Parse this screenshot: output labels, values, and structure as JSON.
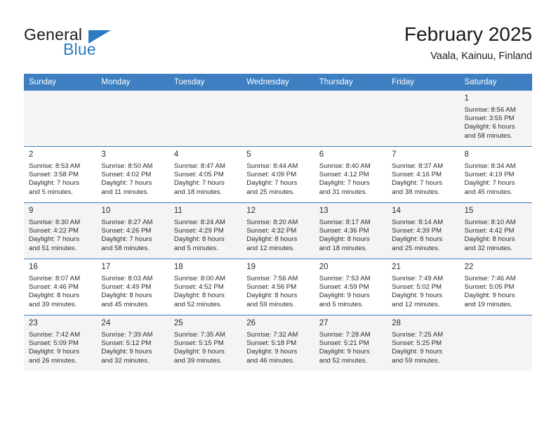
{
  "brand": {
    "name_top": "General",
    "name_bottom": "Blue",
    "accent_color": "#2b7cc0"
  },
  "header": {
    "title": "February 2025",
    "location": "Vaala, Kainuu, Finland"
  },
  "calendar": {
    "header_bg": "#3d7fc1",
    "shaded_row_bg": "#f4f4f4",
    "weekdays": [
      "Sunday",
      "Monday",
      "Tuesday",
      "Wednesday",
      "Thursday",
      "Friday",
      "Saturday"
    ],
    "weeks": [
      [
        {
          "day": "",
          "lines": []
        },
        {
          "day": "",
          "lines": []
        },
        {
          "day": "",
          "lines": []
        },
        {
          "day": "",
          "lines": []
        },
        {
          "day": "",
          "lines": []
        },
        {
          "day": "",
          "lines": []
        },
        {
          "day": "1",
          "lines": [
            "Sunrise: 8:56 AM",
            "Sunset: 3:55 PM",
            "Daylight: 6 hours",
            "and 58 minutes."
          ]
        }
      ],
      [
        {
          "day": "2",
          "lines": [
            "Sunrise: 8:53 AM",
            "Sunset: 3:58 PM",
            "Daylight: 7 hours",
            "and 5 minutes."
          ]
        },
        {
          "day": "3",
          "lines": [
            "Sunrise: 8:50 AM",
            "Sunset: 4:02 PM",
            "Daylight: 7 hours",
            "and 11 minutes."
          ]
        },
        {
          "day": "4",
          "lines": [
            "Sunrise: 8:47 AM",
            "Sunset: 4:05 PM",
            "Daylight: 7 hours",
            "and 18 minutes."
          ]
        },
        {
          "day": "5",
          "lines": [
            "Sunrise: 8:44 AM",
            "Sunset: 4:09 PM",
            "Daylight: 7 hours",
            "and 25 minutes."
          ]
        },
        {
          "day": "6",
          "lines": [
            "Sunrise: 8:40 AM",
            "Sunset: 4:12 PM",
            "Daylight: 7 hours",
            "and 31 minutes."
          ]
        },
        {
          "day": "7",
          "lines": [
            "Sunrise: 8:37 AM",
            "Sunset: 4:16 PM",
            "Daylight: 7 hours",
            "and 38 minutes."
          ]
        },
        {
          "day": "8",
          "lines": [
            "Sunrise: 8:34 AM",
            "Sunset: 4:19 PM",
            "Daylight: 7 hours",
            "and 45 minutes."
          ]
        }
      ],
      [
        {
          "day": "9",
          "lines": [
            "Sunrise: 8:30 AM",
            "Sunset: 4:22 PM",
            "Daylight: 7 hours",
            "and 51 minutes."
          ]
        },
        {
          "day": "10",
          "lines": [
            "Sunrise: 8:27 AM",
            "Sunset: 4:26 PM",
            "Daylight: 7 hours",
            "and 58 minutes."
          ]
        },
        {
          "day": "11",
          "lines": [
            "Sunrise: 8:24 AM",
            "Sunset: 4:29 PM",
            "Daylight: 8 hours",
            "and 5 minutes."
          ]
        },
        {
          "day": "12",
          "lines": [
            "Sunrise: 8:20 AM",
            "Sunset: 4:32 PM",
            "Daylight: 8 hours",
            "and 12 minutes."
          ]
        },
        {
          "day": "13",
          "lines": [
            "Sunrise: 8:17 AM",
            "Sunset: 4:36 PM",
            "Daylight: 8 hours",
            "and 18 minutes."
          ]
        },
        {
          "day": "14",
          "lines": [
            "Sunrise: 8:14 AM",
            "Sunset: 4:39 PM",
            "Daylight: 8 hours",
            "and 25 minutes."
          ]
        },
        {
          "day": "15",
          "lines": [
            "Sunrise: 8:10 AM",
            "Sunset: 4:42 PM",
            "Daylight: 8 hours",
            "and 32 minutes."
          ]
        }
      ],
      [
        {
          "day": "16",
          "lines": [
            "Sunrise: 8:07 AM",
            "Sunset: 4:46 PM",
            "Daylight: 8 hours",
            "and 39 minutes."
          ]
        },
        {
          "day": "17",
          "lines": [
            "Sunrise: 8:03 AM",
            "Sunset: 4:49 PM",
            "Daylight: 8 hours",
            "and 45 minutes."
          ]
        },
        {
          "day": "18",
          "lines": [
            "Sunrise: 8:00 AM",
            "Sunset: 4:52 PM",
            "Daylight: 8 hours",
            "and 52 minutes."
          ]
        },
        {
          "day": "19",
          "lines": [
            "Sunrise: 7:56 AM",
            "Sunset: 4:56 PM",
            "Daylight: 8 hours",
            "and 59 minutes."
          ]
        },
        {
          "day": "20",
          "lines": [
            "Sunrise: 7:53 AM",
            "Sunset: 4:59 PM",
            "Daylight: 9 hours",
            "and 5 minutes."
          ]
        },
        {
          "day": "21",
          "lines": [
            "Sunrise: 7:49 AM",
            "Sunset: 5:02 PM",
            "Daylight: 9 hours",
            "and 12 minutes."
          ]
        },
        {
          "day": "22",
          "lines": [
            "Sunrise: 7:46 AM",
            "Sunset: 5:05 PM",
            "Daylight: 9 hours",
            "and 19 minutes."
          ]
        }
      ],
      [
        {
          "day": "23",
          "lines": [
            "Sunrise: 7:42 AM",
            "Sunset: 5:09 PM",
            "Daylight: 9 hours",
            "and 26 minutes."
          ]
        },
        {
          "day": "24",
          "lines": [
            "Sunrise: 7:39 AM",
            "Sunset: 5:12 PM",
            "Daylight: 9 hours",
            "and 32 minutes."
          ]
        },
        {
          "day": "25",
          "lines": [
            "Sunrise: 7:35 AM",
            "Sunset: 5:15 PM",
            "Daylight: 9 hours",
            "and 39 minutes."
          ]
        },
        {
          "day": "26",
          "lines": [
            "Sunrise: 7:32 AM",
            "Sunset: 5:18 PM",
            "Daylight: 9 hours",
            "and 46 minutes."
          ]
        },
        {
          "day": "27",
          "lines": [
            "Sunrise: 7:28 AM",
            "Sunset: 5:21 PM",
            "Daylight: 9 hours",
            "and 52 minutes."
          ]
        },
        {
          "day": "28",
          "lines": [
            "Sunrise: 7:25 AM",
            "Sunset: 5:25 PM",
            "Daylight: 9 hours",
            "and 59 minutes."
          ]
        },
        {
          "day": "",
          "lines": []
        }
      ]
    ]
  }
}
